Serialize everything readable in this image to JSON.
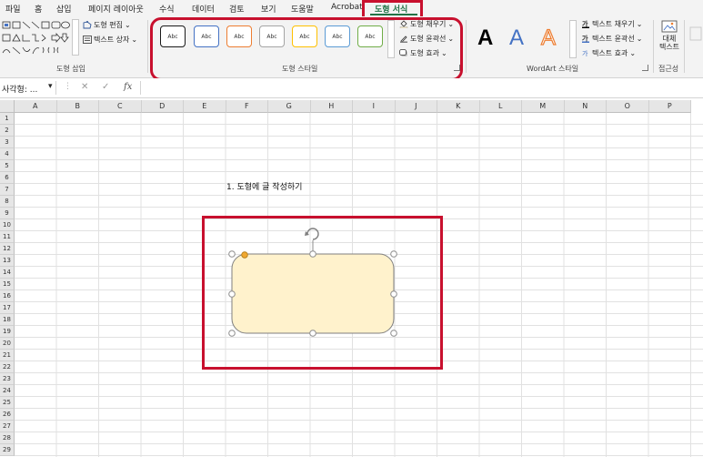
{
  "ribbon_tabs": [
    {
      "label": "파일"
    },
    {
      "label": "홈"
    },
    {
      "label": "삽입"
    },
    {
      "label": "페이지 레이아웃"
    },
    {
      "label": "수식"
    },
    {
      "label": "데이터"
    },
    {
      "label": "검토"
    },
    {
      "label": "보기"
    },
    {
      "label": "도움말"
    },
    {
      "label": "Acrobat"
    },
    {
      "label": "도형 서식"
    }
  ],
  "active_tab": "도형 서식",
  "groups": {
    "insert_shapes": {
      "label": "도형 삽입",
      "edit_shape": "도형 편집",
      "text_box": "텍스트 상자"
    },
    "shape_styles": {
      "label": "도형 스타일",
      "sample_text": "Abc",
      "swatches": [
        "#1a1a1a",
        "#4472c4",
        "#ed7d31",
        "#a5a5a5",
        "#ffc000",
        "#5b9bd5",
        "#70ad47"
      ],
      "fill": "도형 채우기",
      "outline": "도형 윤곽선",
      "effects": "도형 효과"
    },
    "wordart_styles": {
      "label": "WordArt 스타일",
      "letter": "A",
      "text_fill": "텍스트 채우기",
      "text_outline": "텍스트 윤곽선",
      "text_effects": "텍스트 효과"
    },
    "accessibility": {
      "label": "접근성",
      "alt_text_line1": "대체",
      "alt_text_line2": "텍스트"
    }
  },
  "formula_bar": {
    "name_box": "사각형: ...",
    "cancel": "✕",
    "enter": "✓",
    "fx": "fx",
    "value": ""
  },
  "columns": [
    "A",
    "B",
    "C",
    "D",
    "E",
    "F",
    "G",
    "H",
    "I",
    "J",
    "K",
    "L",
    "M",
    "N",
    "O",
    "P"
  ],
  "rows": [
    "1",
    "2",
    "3",
    "4",
    "5",
    "6",
    "7",
    "8",
    "9",
    "10",
    "11",
    "12",
    "13",
    "14",
    "15",
    "16",
    "17",
    "18",
    "19",
    "20",
    "21",
    "22",
    "23",
    "24",
    "25",
    "26",
    "27",
    "28",
    "29"
  ],
  "cell_text": "1. 도형에 글 작성하기",
  "shape": {
    "fill": "#fff2cc",
    "outline": "#7f7f7f"
  },
  "accent_color": "#217346",
  "highlight_color": "#c8102e"
}
